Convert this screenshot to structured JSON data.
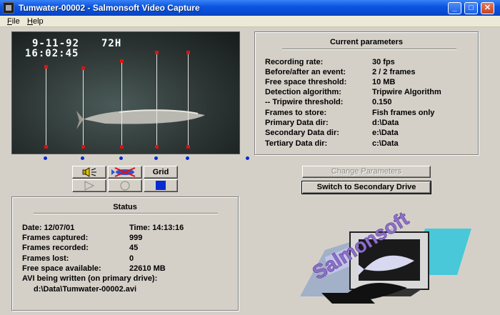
{
  "window": {
    "title": "Tumwater-00002 - Salmonsoft Video Capture",
    "controls": [
      "minimize-icon",
      "maximize-icon",
      "close-icon"
    ]
  },
  "menu": {
    "file": "File",
    "file_accel": "F",
    "file_rest": "ile",
    "help": "Help",
    "help_accel": "H",
    "help_rest": "elp"
  },
  "video": {
    "date_overlay": "9-11-92",
    "tag_overlay": "72H",
    "time_overlay": "16:02:45",
    "tripwires": 5
  },
  "toolbar": {
    "grid_label": "Grid",
    "sound_icon": "speaker-icon",
    "fish_off_icon": "fish-crossed-icon",
    "play_icon": "play-icon",
    "record_icon": "record-circle-icon",
    "stop_icon": "stop-square-icon"
  },
  "current_parameters": {
    "title": "Current parameters",
    "rows": [
      {
        "label": "Recording rate:",
        "value": "30 fps"
      },
      {
        "label": "Before/after an event:",
        "value": "2 / 2 frames"
      },
      {
        "label": "Free space threshold:",
        "value": "10 MB"
      },
      {
        "label": "Detection algorithm:",
        "value": "Tripwire Algorithm"
      },
      {
        "label": "-- Tripwire threshold:",
        "value": "0.150"
      },
      {
        "label": "Frames to store:",
        "value": "Fish frames only"
      },
      {
        "label": "Primary Data dir:",
        "value": "d:\\Data"
      },
      {
        "label": "Secondary Data dir:",
        "value": "e:\\Data"
      },
      {
        "label": "Tertiary Data dir:",
        "value": "c:\\Data"
      }
    ]
  },
  "buttons": {
    "change_parameters": "Change Parameters",
    "switch_drive": "Switch to Secondary Drive"
  },
  "status": {
    "title": "Status",
    "date_label": "Date: 12/07/01",
    "time_label": "Time: 14:13:16",
    "rows": [
      {
        "label": "Frames captured:",
        "value": "999"
      },
      {
        "label": "Frames recorded:",
        "value": "45"
      },
      {
        "label": "Frames lost:",
        "value": "0"
      },
      {
        "label": "Free space available:",
        "value": "22610 MB"
      }
    ],
    "avi_label": "AVI being written (on primary drive):",
    "avi_path": "d:\\Data\\Tumwater-00002.avi"
  },
  "logo": {
    "text": "Salmonsoft"
  },
  "colors": {
    "titlebar": "#0a55e0",
    "tripwire_marker": "#e01010",
    "base_marker": "#0a2bd1",
    "stop_fill": "#0a2bd1"
  }
}
